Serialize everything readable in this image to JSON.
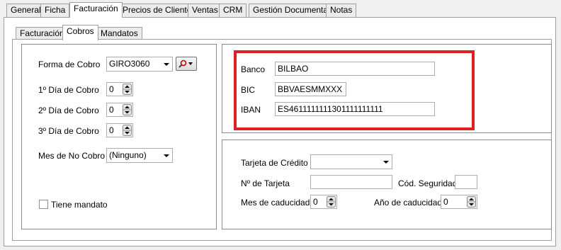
{
  "main_tabs": [
    "General",
    "Ficha",
    "Facturación",
    "Precios de Cliente",
    "Ventas",
    "CRM",
    "Gestión Documental",
    "Notas"
  ],
  "main_tabs_active": "Facturación",
  "sub_tabs": [
    "Facturación",
    "Cobros",
    "Mandatos"
  ],
  "sub_tabs_active": "Cobros",
  "cobro": {
    "forma_label": "Forma de Cobro",
    "forma_value": "GIRO3060",
    "dia1_label": "1º Día de Cobro",
    "dia1_value": "0",
    "dia2_label": "2º Día de Cobro",
    "dia2_value": "0",
    "dia3_label": "3º Día de Cobro",
    "dia3_value": "0",
    "mes_no_cobro_label": "Mes de No Cobro",
    "mes_no_cobro_value": "(Ninguno)",
    "mandato_label": "Tiene mandato",
    "mandato_checked": false
  },
  "banco": {
    "banco_label": "Banco",
    "banco_value": "BILBAO",
    "bic_label": "BIC",
    "bic_value": "BBVAESMMXXX",
    "iban_label": "IBAN",
    "iban_value": "ES4611111111301111111111"
  },
  "tarjeta": {
    "tarjeta_label": "Tarjeta de Crédito",
    "tarjeta_value": "",
    "numero_label": "Nº de Tarjeta",
    "numero_value": "",
    "seguridad_label": "Cód. Seguridad",
    "seguridad_value": "",
    "mes_label": "Mes de caducidad",
    "mes_value": "0",
    "anio_label": "Año de caducidad",
    "anio_value": "0"
  },
  "colors": {
    "highlight": "#e02020",
    "panel_border": "#a0a0a0"
  }
}
